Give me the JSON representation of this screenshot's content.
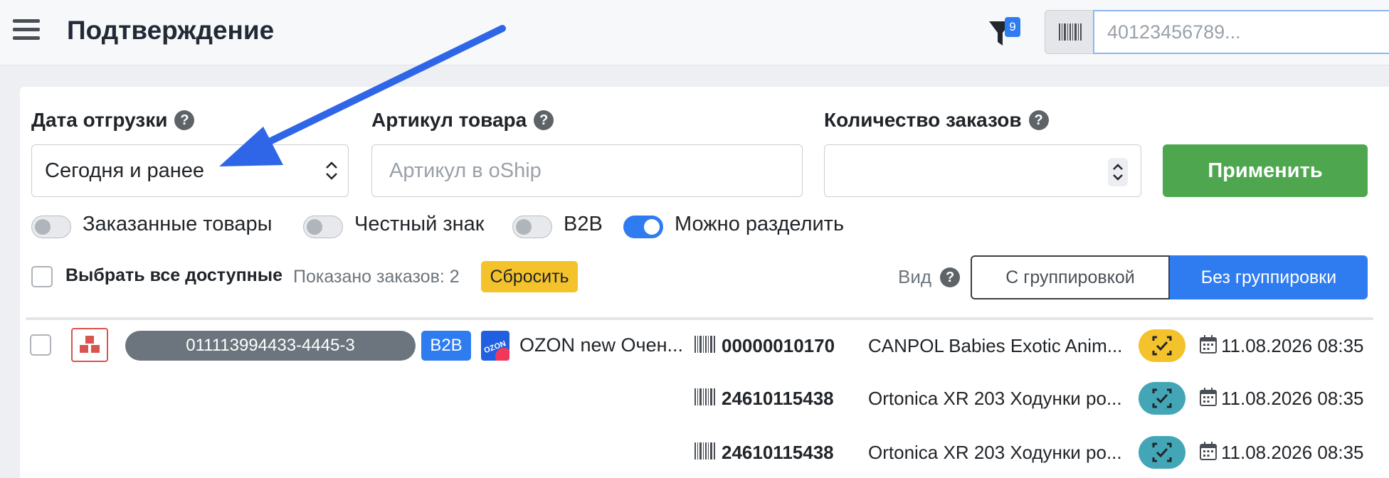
{
  "header": {
    "title": "Подтверждение",
    "filter_badge": "9",
    "scan_placeholder": "40123456789..."
  },
  "filters": {
    "date_label": "Дата отгрузки",
    "date_value": "Сегодня и ранее",
    "article_label": "Артикул товара",
    "article_placeholder": "Артикул в oShip",
    "count_label": "Количество заказов",
    "apply_label": "Применить"
  },
  "toggles": [
    {
      "label": "Заказанные товары",
      "on": false
    },
    {
      "label": "Честный знак",
      "on": false
    },
    {
      "label": "B2B",
      "on": false
    },
    {
      "label": "Можно разделить",
      "on": true
    }
  ],
  "toolbar": {
    "select_all": "Выбрать все доступные",
    "shown_orders": "Показано заказов: 2",
    "reset_label": "Сбросить",
    "view_label": "Вид",
    "view_grouped": "С группировкой",
    "view_ungrouped": "Без группировки"
  },
  "order": {
    "number": "011113994433-4445-3",
    "b2b_badge": "B2B",
    "shop": "OZON new Очен...",
    "items": [
      {
        "sku": "00000010170",
        "name": "CANPOL Babies Exotic Anim...",
        "status_color": "#f4c22b",
        "date": "11.08.2026 08:35"
      },
      {
        "sku": "24610115438",
        "name": "Ortonica XR 203 Ходунки ро...",
        "status_color": "#43a6b7",
        "date": "11.08.2026 08:35"
      },
      {
        "sku": "24610115438",
        "name": "Ortonica XR 203 Ходунки ро...",
        "status_color": "#43a6b7",
        "date": "11.08.2026 08:35"
      }
    ]
  },
  "colors": {
    "accent": "#2f7cf0",
    "apply_green": "#4ea64f",
    "reset_yellow": "#f4c22b",
    "annotation_arrow": "#2f66e8"
  }
}
